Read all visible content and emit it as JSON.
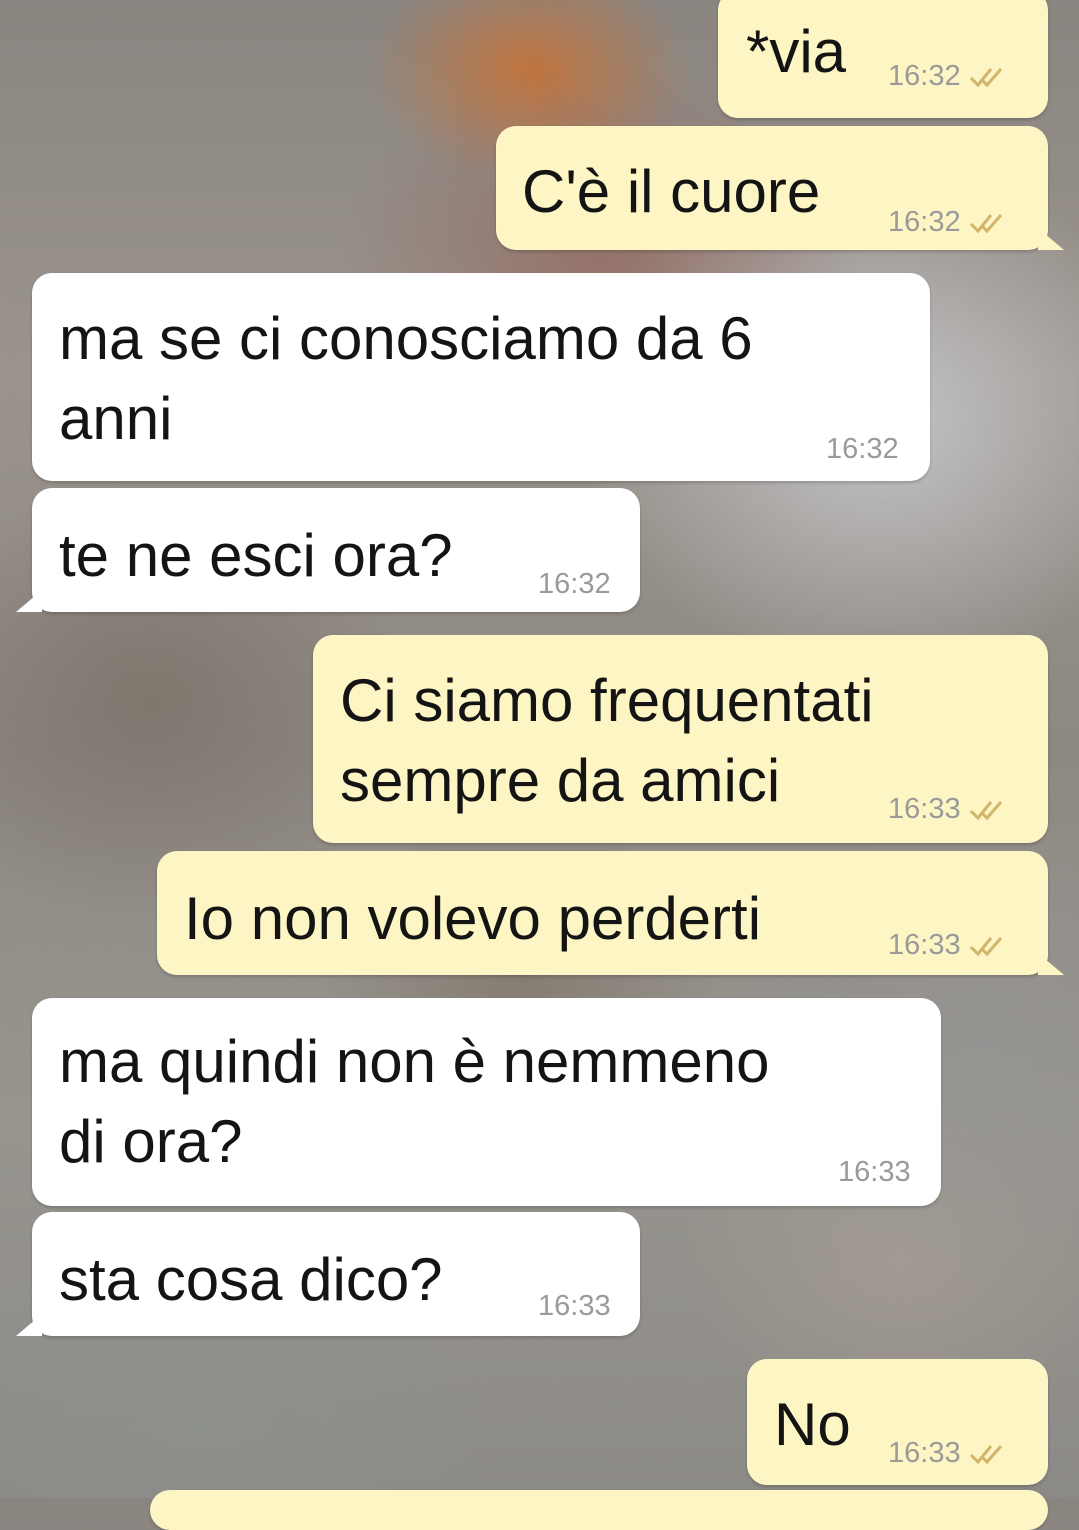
{
  "messages": [
    {
      "dir": "out",
      "text": "*via",
      "time": "16:32",
      "status": "read-double-check"
    },
    {
      "dir": "out",
      "text": "C'è il cuore",
      "time": "16:32",
      "status": "read-double-check"
    },
    {
      "dir": "in",
      "text": "ma se ci conosciamo da 6\nanni",
      "time": "16:32"
    },
    {
      "dir": "in",
      "text": "te ne esci ora?",
      "time": "16:32"
    },
    {
      "dir": "out",
      "text": "Ci siamo frequentati\nsempre da amici",
      "time": "16:33",
      "status": "read-double-check"
    },
    {
      "dir": "out",
      "text": "Io non volevo perderti",
      "time": "16:33",
      "status": "read-double-check"
    },
    {
      "dir": "in",
      "text": "ma quindi non è nemmeno\ndi ora?",
      "time": "16:33"
    },
    {
      "dir": "in",
      "text": "sta cosa dico?",
      "time": "16:33"
    },
    {
      "dir": "out",
      "text": "No",
      "time": "16:33",
      "status": "read-double-check"
    }
  ],
  "colors": {
    "outgoing_bubble": "#fdf6c4",
    "incoming_bubble": "#ffffff",
    "check_color": "#d2b46a",
    "time_color": "#9a9a9a"
  }
}
